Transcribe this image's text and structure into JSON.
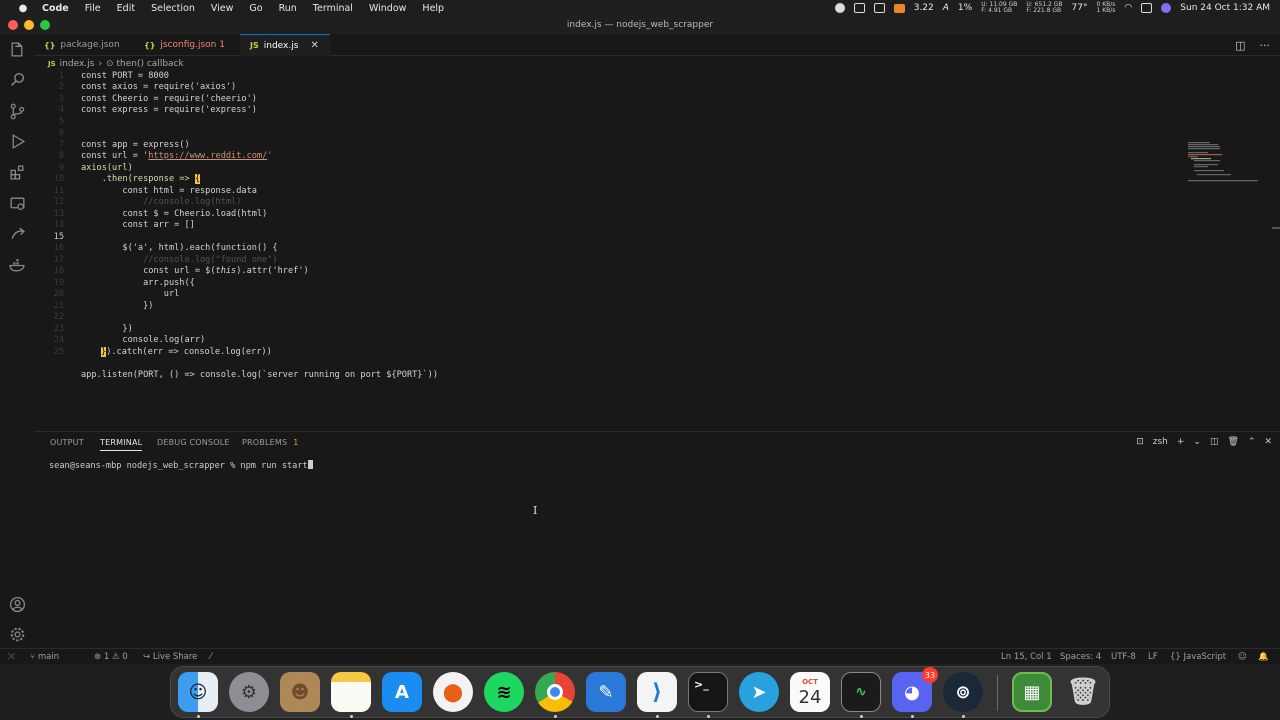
{
  "menubar": {
    "app_name": "Code",
    "items": [
      "File",
      "Edit",
      "Selection",
      "View",
      "Go",
      "Run",
      "Terminal",
      "Window",
      "Help"
    ],
    "status": {
      "cpu": "3.22",
      "battery": "1%",
      "mem1_top": "U: 11.09 GB",
      "mem1_bottom": "F: 4.91 GB",
      "mem2_top": "U: 651.2 GB",
      "mem2_bottom": "F: 221.8 GB",
      "temp": "77°",
      "net_up": "0 KB/s",
      "net_down": "1 KB/s",
      "datetime": "Sun 24 Oct  1:32 AM"
    }
  },
  "window": {
    "title": "index.js — nodejs_web_scrapper"
  },
  "tabs": [
    {
      "label": "package.json",
      "icon": "{}"
    },
    {
      "label": "jsconfig.json 1",
      "icon": "{}"
    },
    {
      "label": "index.js",
      "icon": "JS"
    }
  ],
  "breadcrumb": {
    "file": "index.js",
    "symbol": "then() callback"
  },
  "editor": {
    "current_line": "15",
    "lines": {
      "l1": "const PORT = 8000",
      "l2": "const axios = require('axios')",
      "l3": "const Cheerio = require('cheerio')",
      "l4": "const express = require('express')",
      "l7": "const app = express()",
      "l8a": "const url = '",
      "l8url": "https://www.reddit.com/",
      "l8b": "'",
      "l9": "axios(url)",
      "l10": "    .then(response => ",
      "l11": "        const html = response.data",
      "l12": "            //console.log(html)",
      "l13": "        const $ = Cheerio.load(html)",
      "l14": "        const arr = []",
      "l16": "        $('a', html).each(function() {",
      "l17": "            //console.log(\"found one\")",
      "l18a": "            const url = $(",
      "l18this": "this",
      "l18b": ").attr('href')",
      "l19": "            arr.push({",
      "l20": "                url",
      "l21": "            })",
      "l23": "        })",
      "l24": "        console.log(arr)",
      "l25": ").catch(err => console.log(err))",
      "l27": "app.listen(PORT, () => console.log(`server running on port ${PORT}`))"
    }
  },
  "panel": {
    "tabs": [
      "OUTPUT",
      "TERMINAL",
      "DEBUG CONSOLE",
      "PROBLEMS"
    ],
    "problems_count": "1",
    "shell": "zsh",
    "terminal_line": "sean@seans-mbp nodejs_web_scrapper % npm run start"
  },
  "statusbar": {
    "branch": "main",
    "errors": "1",
    "warnings": "0",
    "live_share": "Live Share",
    "position": "Ln 15, Col 1",
    "spaces": "Spaces: 4",
    "encoding": "UTF-8",
    "eol": "LF",
    "language": "JavaScript"
  },
  "dock": {
    "apps": [
      "Finder",
      "System Preferences",
      "Contacts",
      "Notes",
      "App Store",
      "Hotspot Shield",
      "Spotify",
      "Chrome",
      "Xcode Tools",
      "Visual Studio Code",
      "Terminal",
      "Telegram",
      "Calendar",
      "Activity Monitor",
      "Discord",
      "Steam",
      "Minecraft",
      "Trash"
    ],
    "calendar_month": "OCT",
    "calendar_day": "24",
    "discord_badge": "33"
  },
  "colors": {
    "accent": "#0078d4",
    "editor_bg": "#181818",
    "string": "#ce9178",
    "function": "#dcdcaa"
  }
}
